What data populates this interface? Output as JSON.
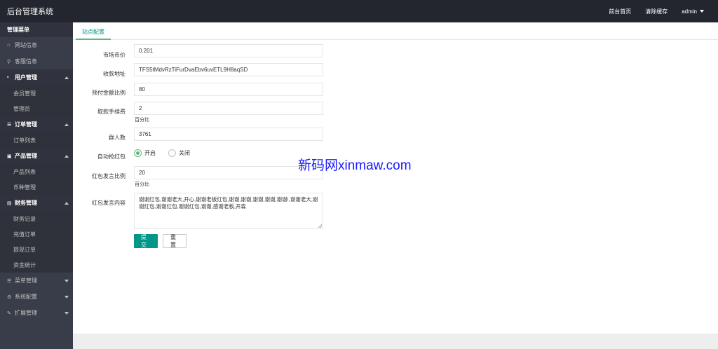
{
  "app": {
    "title": "后台管理系统",
    "nav": [
      {
        "label": "前台首页"
      },
      {
        "label": "清除缓存"
      },
      {
        "label": "admin"
      }
    ]
  },
  "sidebar": {
    "header": "管理菜单",
    "items": [
      {
        "label": "网站信息",
        "icon": "home-icon",
        "kind": "item"
      },
      {
        "label": "客服信息",
        "icon": "link-icon",
        "kind": "item"
      },
      {
        "label": "用户管理",
        "icon": "user-icon",
        "kind": "group",
        "arrow": "up"
      },
      {
        "label": "会员管理",
        "kind": "sub"
      },
      {
        "label": "管理员",
        "kind": "sub"
      },
      {
        "label": "订单管理",
        "icon": "list-icon",
        "kind": "group",
        "arrow": "up"
      },
      {
        "label": "订单列表",
        "kind": "sub"
      },
      {
        "label": "产品管理",
        "icon": "product-icon",
        "kind": "group",
        "arrow": "up"
      },
      {
        "label": "产品列表",
        "kind": "sub"
      },
      {
        "label": "币种管理",
        "kind": "sub"
      },
      {
        "label": "财务管理",
        "icon": "finance-icon",
        "kind": "group",
        "arrow": "up"
      },
      {
        "label": "财务记录",
        "kind": "sub"
      },
      {
        "label": "充值订单",
        "kind": "sub"
      },
      {
        "label": "提现订单",
        "kind": "sub"
      },
      {
        "label": "资金统计",
        "kind": "sub"
      },
      {
        "label": "菜单管理",
        "icon": "menu-icon",
        "kind": "item",
        "arrow": "down"
      },
      {
        "label": "系统配置",
        "icon": "gear-icon",
        "kind": "item",
        "arrow": "down"
      },
      {
        "label": "扩展管理",
        "icon": "wrench-icon",
        "kind": "item",
        "arrow": "down"
      }
    ]
  },
  "tabs": [
    {
      "label": "站点配置"
    }
  ],
  "form": {
    "market_price": {
      "label": "市场币价",
      "value": "0.201"
    },
    "address": {
      "label": "收款地址",
      "value": "TFS5tMdvRzTiFurDvaEbv6uvETL9H8aqSD"
    },
    "prepay_ratio": {
      "label": "预付金额比例",
      "value": "80"
    },
    "withdraw_fee": {
      "label": "取款手续费",
      "value": "2",
      "hint": "百分比"
    },
    "group_count": {
      "label": "群人数",
      "value": "3761"
    },
    "auto_redpack": {
      "label": "自动抢红包",
      "on_label": "开启",
      "off_label": "关闭",
      "selected": "on"
    },
    "redpack_ratio": {
      "label": "红包发言比例",
      "value": "20",
      "hint": "百分比"
    },
    "redpack_content": {
      "label": "红包发言内容",
      "value": "谢谢红包,谢谢老大,开心,谢谢老板红包,谢谢,谢谢,谢谢,谢谢,谢谢!,谢谢老大,谢谢红包,谢谢红包,谢谢红包,谢谢,感谢老板,开森"
    },
    "submit_label": "提交",
    "reset_label": "重置"
  },
  "watermark": "新码网xinmaw.com",
  "colors": {
    "topbar": "#23262e",
    "sidebar": "#393d49",
    "accent": "#009688",
    "radio": "#5fb878"
  }
}
